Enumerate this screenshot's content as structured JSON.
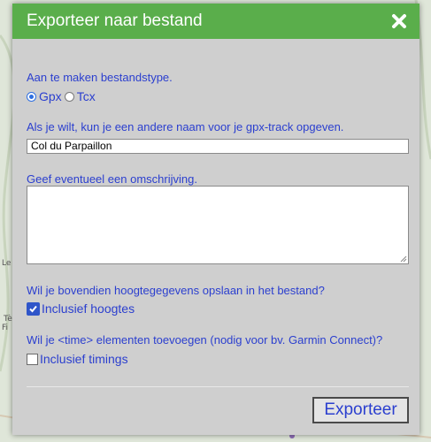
{
  "dialog": {
    "title": "Exporteer naar bestand",
    "close_icon": "close-x-icon",
    "filetype_label": "Aan te maken bestandstype.",
    "filetype_options": [
      {
        "label": "Gpx",
        "checked": true
      },
      {
        "label": "Tcx",
        "checked": false
      }
    ],
    "name_label": "Als je wilt, kun je een andere naam voor je gpx-track opgeven.",
    "name_value": "Col du Parpaillon",
    "description_label": "Geef eventueel een omschrijving.",
    "description_value": "",
    "elevation_question": "Wil je bovendien hoogtegegevens opslaan in het bestand?",
    "elevation_checkbox": {
      "label": "Inclusief hoogtes",
      "checked": true
    },
    "timings_question": "Wil je <time> elementen toevoegen (nodig voor bv. Garmin Connect)?",
    "timings_checkbox": {
      "label": "Inclusief timings",
      "checked": false
    },
    "export_button": "Exporteer"
  },
  "colors": {
    "titlebar": "#5aae4b",
    "text_blue": "#2b3fcf",
    "dialog_bg": "#cfcfcf"
  }
}
